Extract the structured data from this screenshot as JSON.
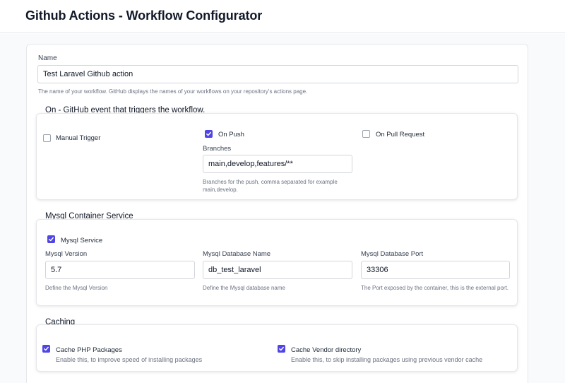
{
  "header": {
    "title": "Github Actions - Workflow Configurator"
  },
  "name_field": {
    "label": "Name",
    "value": "Test Laravel Github action",
    "help": "The name of your workflow. GitHub displays the names of your workflows on your repository's actions page."
  },
  "on_section": {
    "title": "On - GitHub event that triggers the workflow.",
    "manual_trigger": {
      "label": "Manual Trigger",
      "checked": false
    },
    "on_push": {
      "label": "On Push",
      "checked": true
    },
    "on_pull_request": {
      "label": "On Pull Request",
      "checked": false
    },
    "branches": {
      "label": "Branches",
      "value": "main,develop,features/**",
      "help": "Branches for the push, comma separated for example main,develop."
    }
  },
  "mysql_section": {
    "title": "Mysql Container Service",
    "service": {
      "label": "Mysql Service",
      "checked": true
    },
    "version": {
      "label": "Mysql Version",
      "value": "5.7",
      "help": "Define the Mysql Version"
    },
    "db_name": {
      "label": "Mysql Database Name",
      "value": "db_test_laravel",
      "help": "Define the Mysql database name"
    },
    "db_port": {
      "label": "Mysql Database Port",
      "value": "33306",
      "help": "The Port exposed by the container, this is the external port."
    }
  },
  "caching_section": {
    "title": "Caching",
    "php_packages": {
      "label": "Cache PHP Packages",
      "help": "Enable this, to improve speed of installing packages",
      "checked": true
    },
    "vendor_directory": {
      "label": "Cache Vendor directory",
      "help": "Enable this, to skip installing packages using previous vendor cache",
      "checked": true
    }
  },
  "colors": {
    "accent": "#4f46e5",
    "border": "#d1d5db",
    "muted_text": "#6b7280"
  },
  "icons": {
    "checked": "check-icon"
  }
}
